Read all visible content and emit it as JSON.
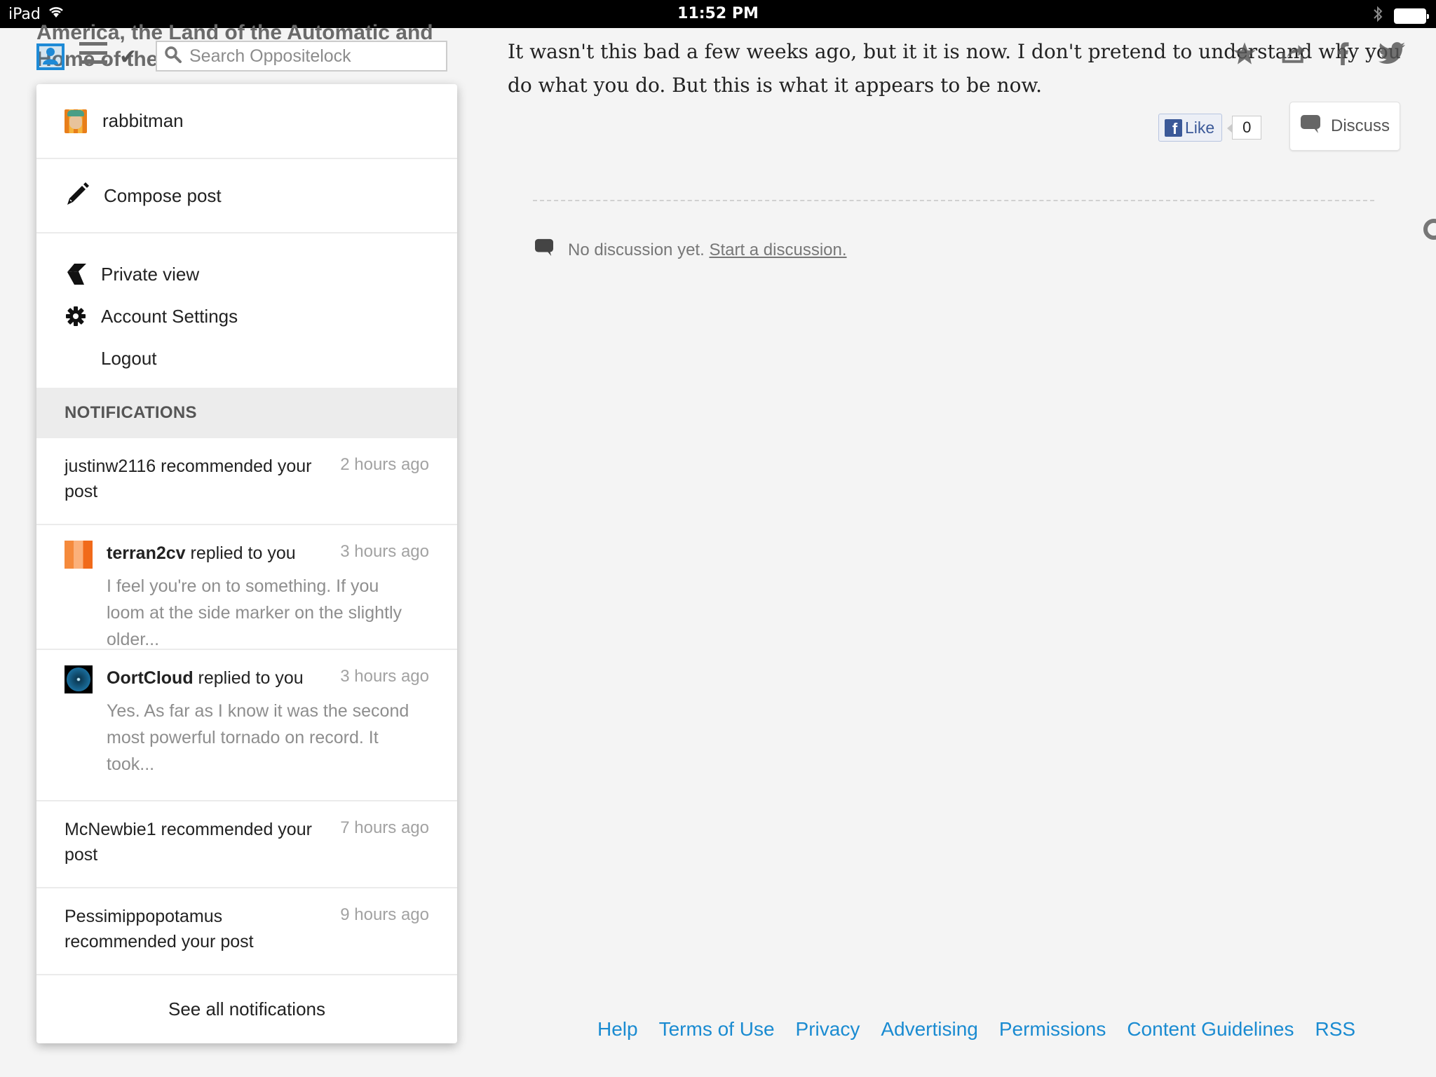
{
  "status_bar": {
    "device": "iPad",
    "time": "11:52 PM"
  },
  "site_header": {
    "title": "America, the Land of the Automatic and Home of the Bad Driver",
    "search_placeholder": "Search Oppositelock"
  },
  "account_menu": {
    "username": "rabbitman",
    "compose_label": "Compose post",
    "items": [
      {
        "label": "Private view",
        "icon": "kinja-logo-icon"
      },
      {
        "label": "Account Settings",
        "icon": "gear-icon"
      },
      {
        "label": "Logout",
        "icon": ""
      }
    ]
  },
  "notifications": {
    "header": "NOTIFICATIONS",
    "items": [
      {
        "type": "recommend",
        "text": "justinw2116 recommended your post",
        "time": "2 hours ago"
      },
      {
        "type": "reply",
        "user": "terran2cv",
        "action": " replied to you",
        "time": "3 hours ago",
        "excerpt": "I feel you're on to something. If you loom at the side marker on the slightly older..."
      },
      {
        "type": "reply",
        "user": "OortCloud",
        "action": " replied to you",
        "time": "3 hours ago",
        "excerpt": "Yes. As far as I know it was the second most powerful tornado on record. It took..."
      },
      {
        "type": "recommend",
        "text": "McNewbie1 recommended your post",
        "time": "7 hours ago"
      },
      {
        "type": "recommend",
        "text": "Pessimippopotamus recommended your post",
        "time": "9 hours ago"
      }
    ],
    "see_all_label": "See all notifications"
  },
  "article": {
    "text": "It wasn't this bad a few weeks ago, but it it is now. I don't pretend to understand why you do what you do. But this is what it appears to be now."
  },
  "social": {
    "like_label": "Like",
    "like_count": "0",
    "discuss_label": "Discuss"
  },
  "discussion": {
    "empty_text": "No discussion yet.",
    "start_link": "Start a discussion."
  },
  "footer": {
    "links": [
      "Help",
      "Terms of Use",
      "Privacy",
      "Advertising",
      "Permissions",
      "Content Guidelines",
      "RSS"
    ]
  },
  "colors": {
    "link": "#1a8bd1",
    "facebook": "#3b5998",
    "accent": "#1e8ad6"
  }
}
